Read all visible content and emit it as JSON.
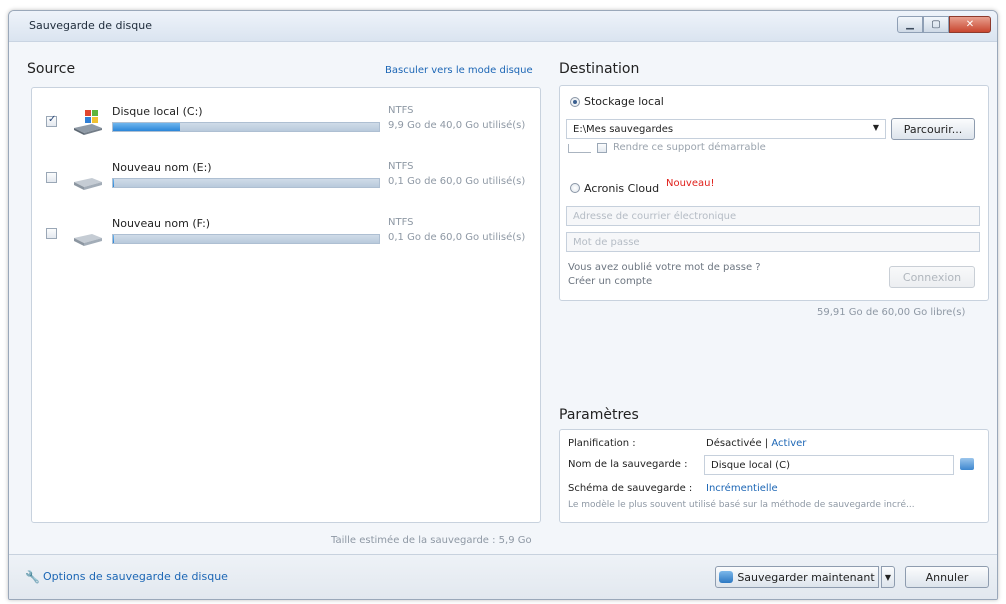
{
  "window": {
    "title": "Sauvegarde de disque"
  },
  "source": {
    "title": "Source",
    "switch_link": "Basculer vers le mode disque",
    "disks": [
      {
        "name": "Disque local (C:)",
        "fs": "NTFS",
        "usage": "9,9 Go de 40,0 Go utilisé(s)",
        "checked": true,
        "used_fraction": 0.25
      },
      {
        "name": "Nouveau nom (E:)",
        "fs": "NTFS",
        "usage": "0,1 Go de 60,0 Go utilisé(s)",
        "checked": false,
        "used_fraction": 0.002
      },
      {
        "name": "Nouveau nom (F:)",
        "fs": "NTFS",
        "usage": "0,1 Go de 60,0 Go utilisé(s)",
        "checked": false,
        "used_fraction": 0.002
      }
    ],
    "estimate": "Taille estimée de la sauvegarde : 5,9 Go"
  },
  "destination": {
    "title": "Destination",
    "local_label": "Stockage local",
    "path": "E:\\Mes sauvegardes",
    "browse_label": "Parcourir...",
    "bootable_label": "Rendre ce support démarrable",
    "cloud_label": "Acronis Cloud",
    "cloud_badge": "Nouveau!",
    "email_placeholder": "Adresse de courrier électronique",
    "password_placeholder": "Mot de passe",
    "forgot_label": "Vous avez oublié votre mot de passe ?",
    "create_label": "Créer un compte",
    "connect_label": "Connexion",
    "free_space": "59,91 Go de 60,00 Go libre(s)"
  },
  "params": {
    "title": "Paramètres",
    "schedule_label": "Planification :",
    "schedule_value": "Désactivée",
    "schedule_separator": "|",
    "schedule_link": "Activer",
    "name_label": "Nom de la sauvegarde :",
    "name_value": "Disque local (C)",
    "scheme_label": "Schéma de sauvegarde :",
    "scheme_value": "Incrémentielle",
    "scheme_desc": "Le modèle le plus souvent utilisé basé sur la méthode de sauvegarde incré..."
  },
  "footer": {
    "options_link": "Options de sauvegarde de disque",
    "backup_now": "Sauvegarder maintenant",
    "cancel": "Annuler"
  },
  "colors": {
    "accent": "#1c66b5",
    "badge": "#e0201b",
    "bar_fill": "#2b86d8"
  }
}
